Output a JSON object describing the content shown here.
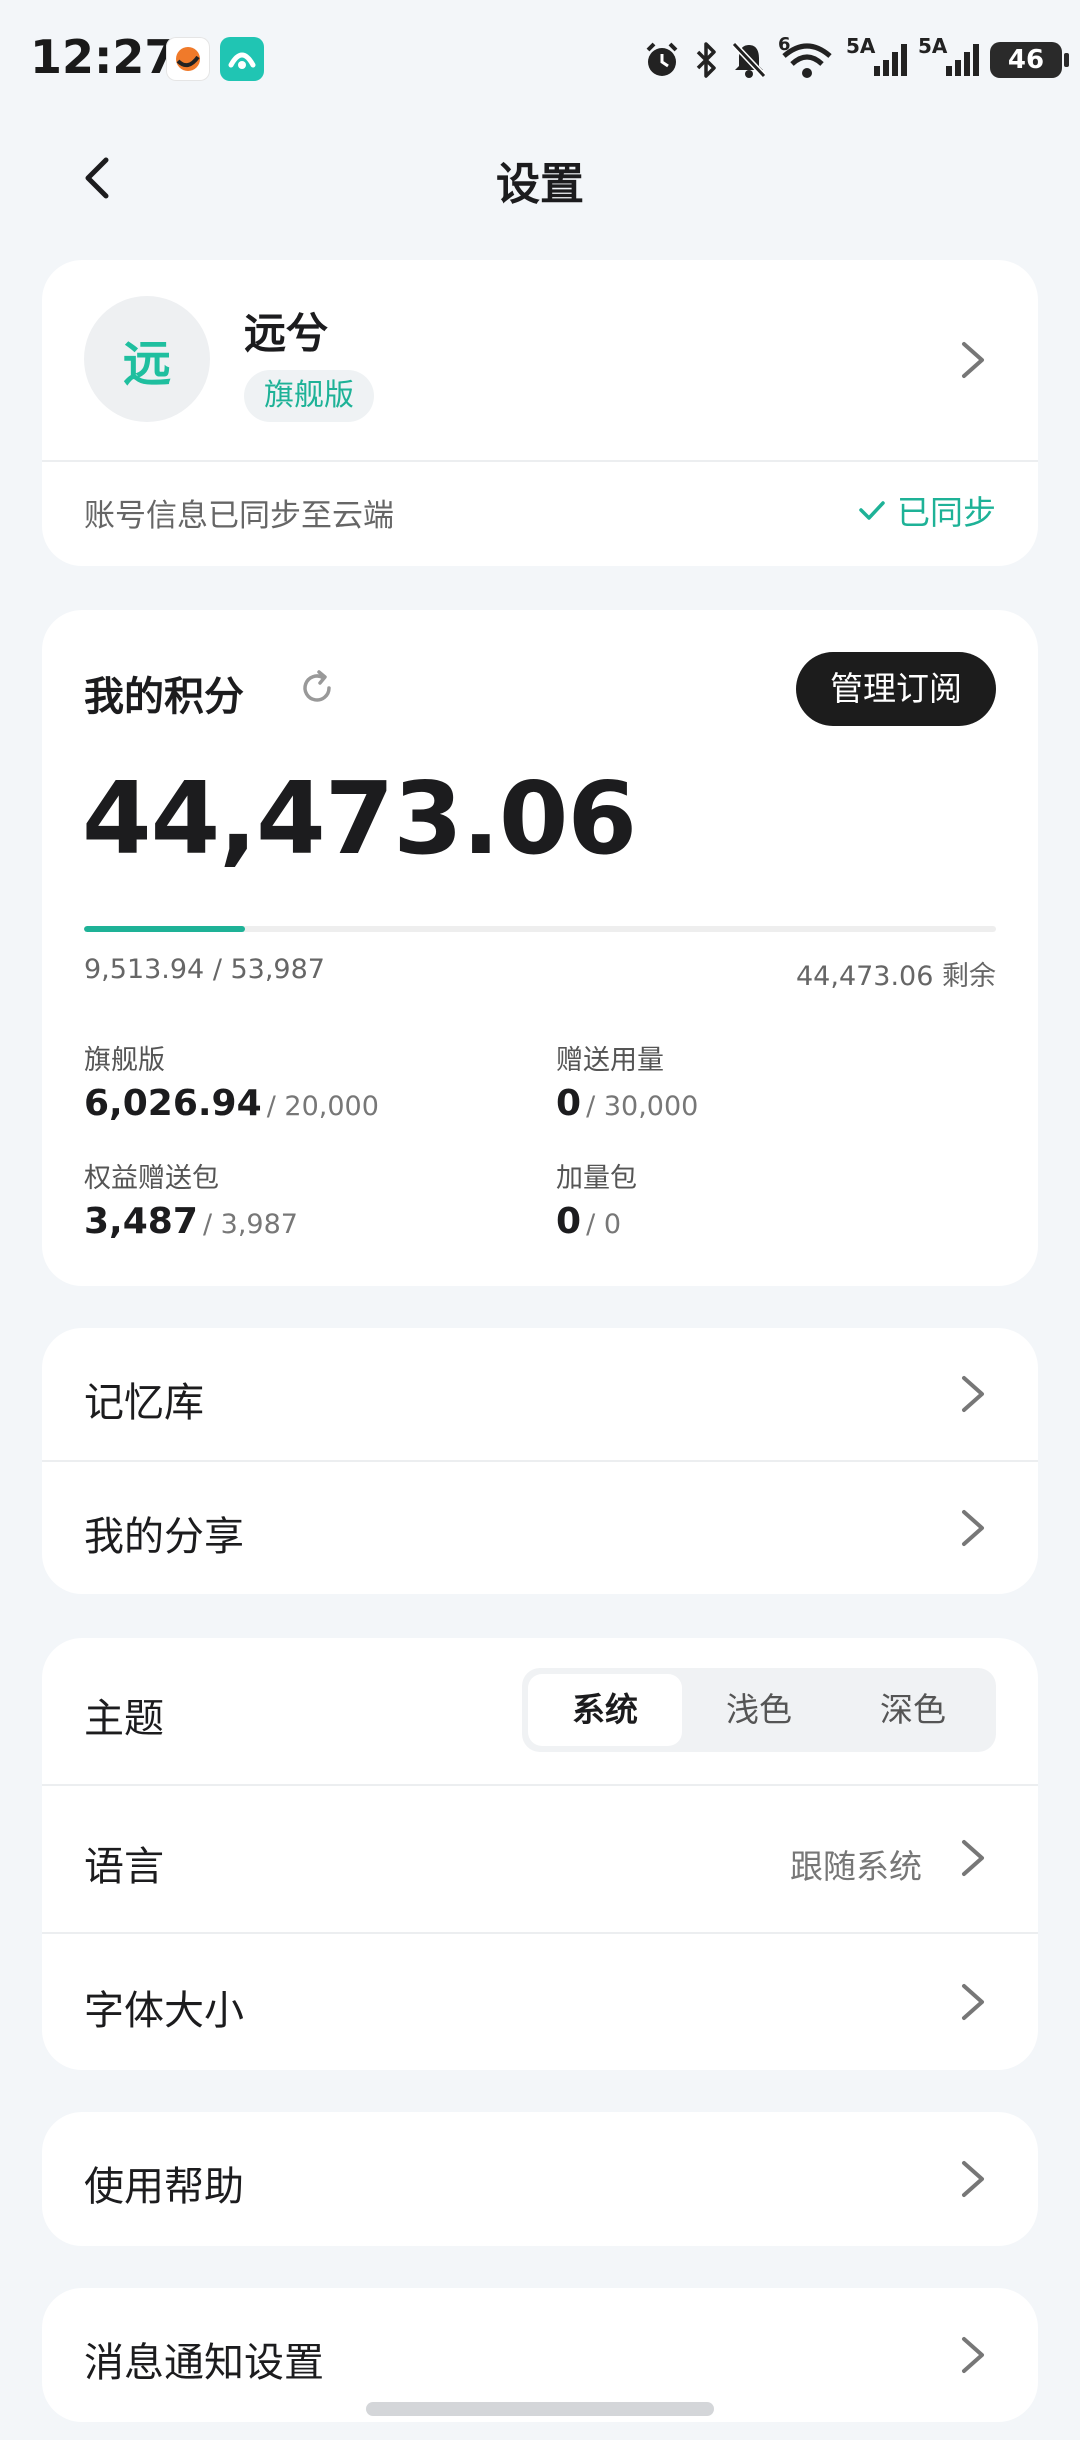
{
  "status_bar": {
    "time": "12:27",
    "battery": "46",
    "network_1": "5A",
    "network_2": "5A",
    "wifi_label": "6"
  },
  "header": {
    "title": "设置"
  },
  "profile": {
    "avatar_text": "远",
    "name": "远兮",
    "plan_badge": "旗舰版",
    "sync_message": "账号信息已同步至云端",
    "sync_status": "已同步"
  },
  "points": {
    "title": "我的积分",
    "manage_label": "管理订阅",
    "total": "44,473.06",
    "progress_fraction": 0.176,
    "usage": "9,513.94 / 53,987",
    "remaining": "44,473.06 剩余",
    "items": [
      {
        "label": "旗舰版",
        "value": "6,026.94",
        "total": "/ 20,000"
      },
      {
        "label": "赠送用量",
        "value": "0",
        "total": "/ 30,000"
      },
      {
        "label": "权益赠送包",
        "value": "3,487",
        "total": "/ 3,987"
      },
      {
        "label": "加量包",
        "value": "0",
        "total": "/ 0"
      }
    ]
  },
  "menu_group_1": {
    "memory": "记忆库",
    "my_shares": "我的分享"
  },
  "menu_group_2": {
    "theme_label": "主题",
    "theme_options": [
      "系统",
      "浅色",
      "深色"
    ],
    "theme_selected": "系统",
    "language_label": "语言",
    "language_value": "跟随系统",
    "font_size_label": "字体大小"
  },
  "menu_group_3": {
    "help": "使用帮助"
  },
  "menu_group_4": {
    "notifications": "消息通知设置"
  },
  "colors": {
    "accent": "#1eb297",
    "background": "#f3f6f9",
    "dark_button": "#1c1c1c"
  }
}
